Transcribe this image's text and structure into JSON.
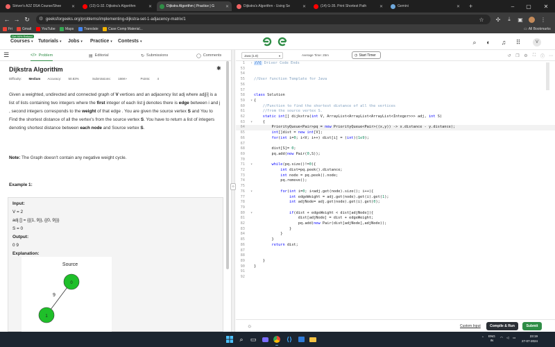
{
  "browser": {
    "tabs": [
      {
        "label": "Striver's A2Z DSA Course/Shee",
        "color": "#f06262",
        "active": false
      },
      {
        "label": "(13) G-32. Dijkstra's Algorithm",
        "color": "#ff0000",
        "active": false
      },
      {
        "label": "Dijkstra Algorithm | Practice | G",
        "color": "#2f8d46",
        "active": true
      },
      {
        "label": "Dijkstra's Algorithm - Using Se",
        "color": "#f06262",
        "active": false
      },
      {
        "label": "(14) G-35. Print Shortest Path",
        "color": "#ff0000",
        "active": false
      },
      {
        "label": "Gemini",
        "color": "#6fa8dc",
        "active": false
      }
    ],
    "new_tab": "+",
    "url": "geeksforgeeks.org/problems/implementing-dijkstra-set-1-adjacency-matrix/1",
    "bookmarks": [
      {
        "label": "Fri",
        "color": "#ea4335"
      },
      {
        "label": "Gmail",
        "color": "#ea4335"
      },
      {
        "label": "YouTube",
        "color": "#ff0000"
      },
      {
        "label": "Maps",
        "color": "#34a853"
      },
      {
        "label": "Translate",
        "color": "#4285f4"
      },
      {
        "label": "Case Comp Material...",
        "color": "#f4b400"
      }
    ],
    "all_bookmarks": "All Bookmarks"
  },
  "gfg_nav": {
    "badge": "Get 90% Refund",
    "items": [
      "Courses",
      "Tutorials",
      "Jobs",
      "Practice",
      "Contests"
    ],
    "logo_color": "#2f8d46",
    "avatar": "V"
  },
  "left_tabs": [
    {
      "label": "Problem",
      "icon": "</>",
      "active": true
    },
    {
      "label": "Editorial",
      "icon": "▤",
      "active": false
    },
    {
      "label": "Submissions",
      "icon": "↻",
      "active": false
    },
    {
      "label": "Comments",
      "icon": "◯",
      "active": false
    }
  ],
  "problem": {
    "title": "Dijkstra Algorithm",
    "difficulty_label": "Difficulty:",
    "difficulty": "Medium",
    "accuracy_label": "Accuracy:",
    "accuracy": "50.83%",
    "submissions_label": "Submissions:",
    "submissions": "166K+",
    "points_label": "Points:",
    "points": "4",
    "desc": {
      "p1": "Given a weighted, undirected and connected graph of ",
      "V": "V",
      "p2": " vertices and an adjacency list adj where adj[i] is a list of lists containing two integers where the ",
      "first": "first",
      "p3": " integer of each list ",
      "j": "j",
      "p4": " denotes there is ",
      "edge": "edge",
      "p5": " between i and j , second integers corresponds to the ",
      "weight": "weight",
      "p6": " of that  edge . You are given the source vertex ",
      "S": "S",
      "p7": " and You to Find the shortest distance of all the vertex's from the source vertex ",
      "S2": "S",
      "p8": ". You have to return a list of integers denoting shortest distance between ",
      "eachnode": "each node",
      "p9": " and Source vertex ",
      "S3": "S",
      "p10": "."
    },
    "note_label": "Note:",
    "note": " The Graph doesn't contain any negative weight cycle.",
    "example_heading": "Example 1:",
    "example": {
      "input_label": "Input:",
      "v_line": "V = 2",
      "adj_line": "adj [] = {{{1, 9}}, {{0, 9}}}",
      "s_line": "S = 0",
      "output_label": "Output:",
      "output": "0 9",
      "explanation_label": "Explanation:",
      "graph_title": "Source",
      "node0": "0",
      "node1": "1",
      "weight": "9"
    }
  },
  "editor": {
    "language": "Java (1.8)",
    "avg_time": "Average Time: 25m",
    "start_timer": "Start Timer",
    "bottom": {
      "custom_input": "Custom Input",
      "compile_run": "Compile & Run",
      "submit": "Submit"
    }
  },
  "taskbar": {
    "lang": "ENG",
    "region": "IN",
    "time": "23:19",
    "date": "27-07-2024"
  }
}
